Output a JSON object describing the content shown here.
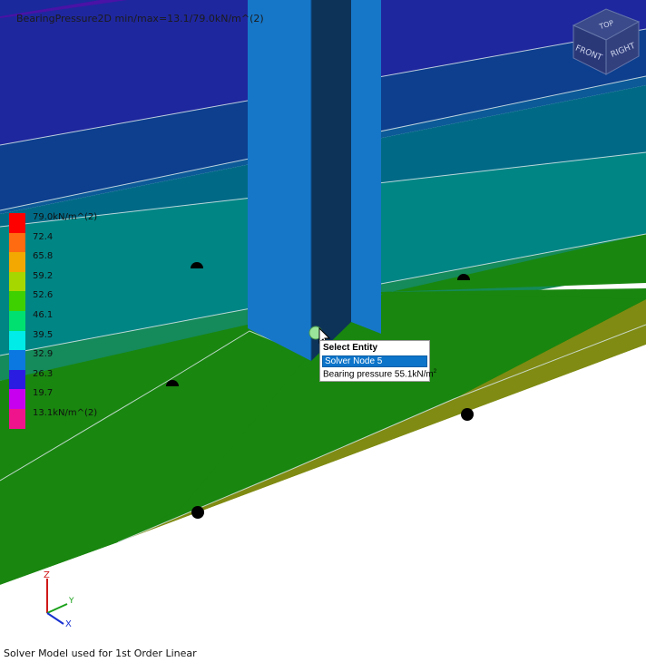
{
  "viewport": {
    "title": "BearingPressure2D min/max=13.1/79.0kN/m^(2)"
  },
  "legend": {
    "items": [
      {
        "label": "79.0kN/m^(2)",
        "color": "#ff0000"
      },
      {
        "label": "72.4",
        "color": "#ff6b10"
      },
      {
        "label": "65.8",
        "color": "#f2a800"
      },
      {
        "label": "59.2",
        "color": "#a6d800"
      },
      {
        "label": "52.6",
        "color": "#3fd000"
      },
      {
        "label": "46.1",
        "color": "#00e070"
      },
      {
        "label": "39.5",
        "color": "#00ece8"
      },
      {
        "label": "32.9",
        "color": "#0a78e0"
      },
      {
        "label": "26.3",
        "color": "#2a1ce0"
      },
      {
        "label": "19.7",
        "color": "#c800f0"
      },
      {
        "label": "13.1kN/m^(2)",
        "color": "#f0148c"
      }
    ]
  },
  "view_cube": {
    "faces": {
      "top": "TOP",
      "front": "FRONT",
      "right": "RIGHT"
    },
    "icon": "view-cube-icon"
  },
  "popup": {
    "title": "Select Entity",
    "selected": "Solver Node 5",
    "value_prefix": "Bearing pressure 55.1kN/m",
    "value_exp": "2"
  },
  "triad": {
    "z": "Z",
    "y": "Y",
    "x": "X"
  },
  "status": {
    "text": "Solver Model used for 1st Order Linear"
  },
  "colors": {
    "green_zone": "#19860f",
    "olive_zone": "#7f8b12",
    "column": "#1677c9",
    "column_dark": "#0d3358"
  }
}
